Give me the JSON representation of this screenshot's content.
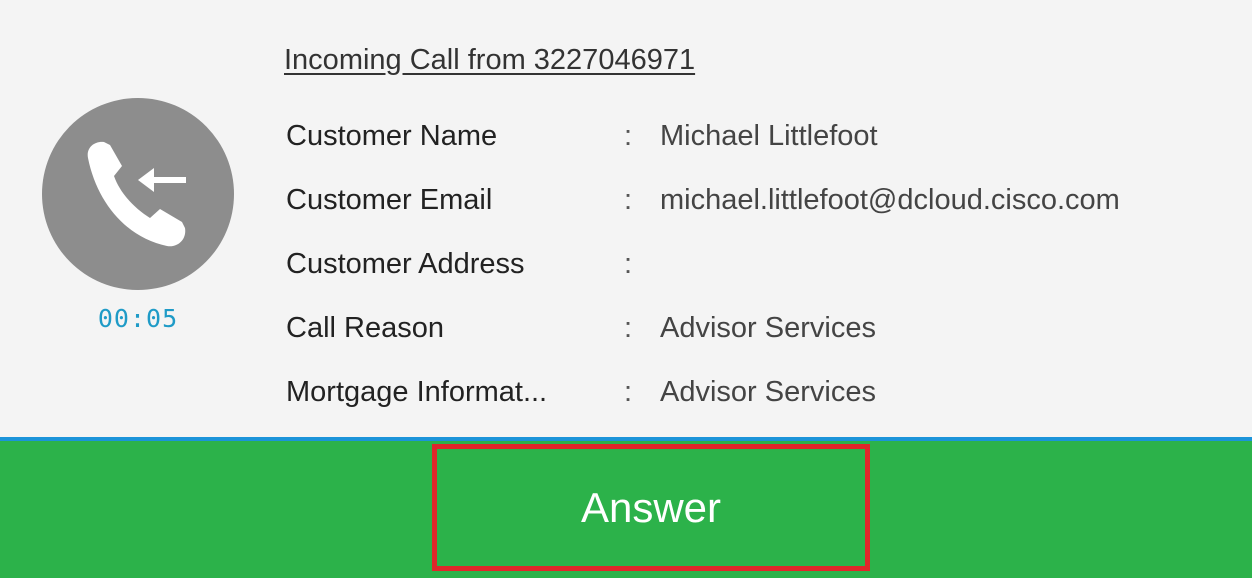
{
  "call": {
    "title": "Incoming Call from 3227046971",
    "timer": "00:05",
    "separator": ":"
  },
  "fields": [
    {
      "label": "Customer Name",
      "value": "Michael Littlefoot"
    },
    {
      "label": "Customer Email",
      "value": "michael.littlefoot@dcloud.cisco.com"
    },
    {
      "label": "Customer Address",
      "value": ""
    },
    {
      "label": "Call Reason",
      "value": "Advisor Services"
    },
    {
      "label": "Mortgage Informat...",
      "value": "Advisor Services"
    }
  ],
  "actions": {
    "answer_label": "Answer"
  },
  "icons": {
    "avatar": "incoming-call-icon"
  },
  "colors": {
    "answer_bg": "#2cb24a",
    "highlight_border": "#e0262a",
    "divider": "#1c94d9",
    "timer": "#1f9bc7"
  }
}
